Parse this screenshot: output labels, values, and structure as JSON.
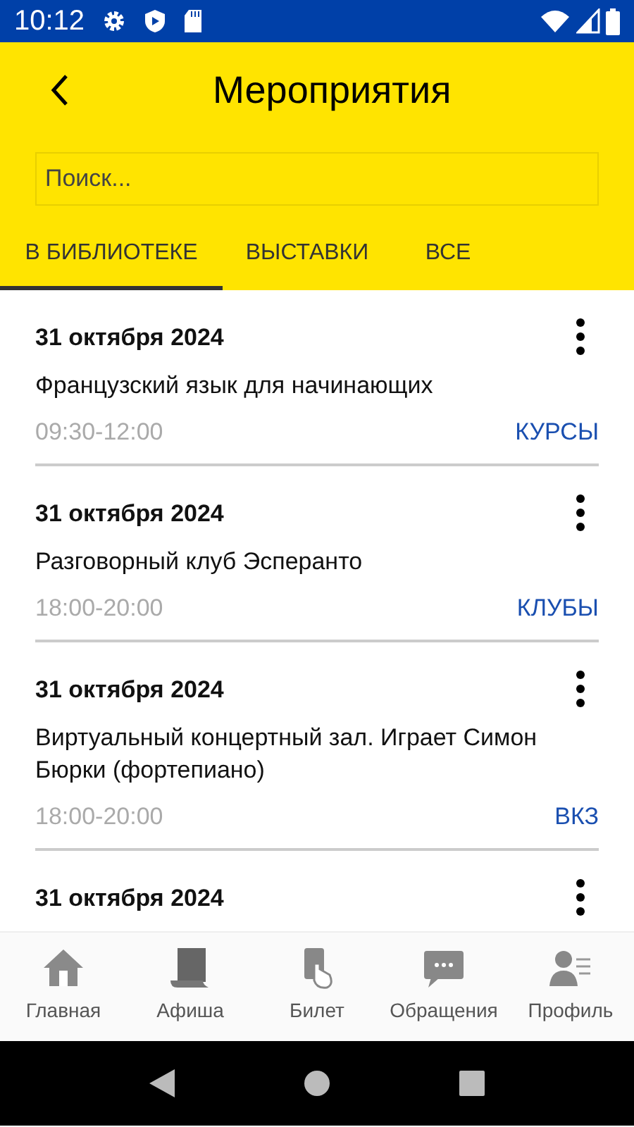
{
  "status_bar": {
    "time": "10:12"
  },
  "header": {
    "title": "Мероприятия",
    "search": {
      "placeholder": "Поиск..."
    }
  },
  "tabs": [
    {
      "label": "В БИБЛИОТЕКЕ",
      "selected": true
    },
    {
      "label": "ВЫСТАВКИ",
      "selected": false
    },
    {
      "label": "ВСЕ",
      "selected": false
    }
  ],
  "events": [
    {
      "date": "31 октября 2024",
      "title": "Французский язык для начинающих",
      "time": "09:30-12:00",
      "category": "КУРСЫ"
    },
    {
      "date": "31 октября 2024",
      "title": "Разговорный клуб Эсперанто",
      "time": "18:00-20:00",
      "category": "КЛУБЫ"
    },
    {
      "date": "31 октября 2024",
      "title": "Виртуальный концертный зал. Играет Симон Бюрки (фортепиано)",
      "time": "18:00-20:00",
      "category": "ВКЗ"
    },
    {
      "date": "31 октября 2024"
    }
  ],
  "bottom_nav": [
    {
      "kind": "home",
      "label": "Главная"
    },
    {
      "kind": "poster",
      "label": "Афиша"
    },
    {
      "kind": "ticket",
      "label": "Билет"
    },
    {
      "kind": "chat",
      "label": "Обращения"
    },
    {
      "kind": "profile",
      "label": "Профиль"
    }
  ]
}
